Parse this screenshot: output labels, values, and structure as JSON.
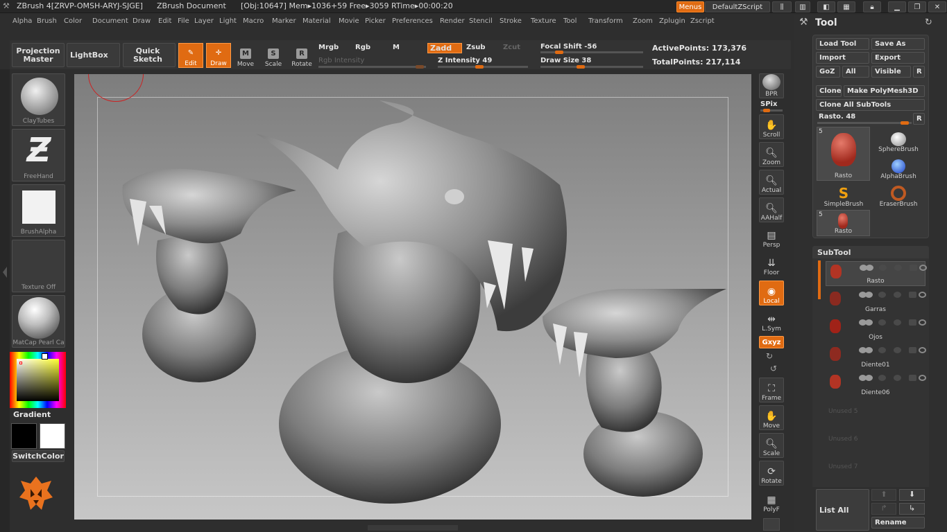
{
  "titlebar": {
    "app": "ZBrush 4[ZRVP-OMSH-ARYJ-SJGE]",
    "doc": "ZBrush Document",
    "stats": "[Obj:10647] Mem▸1036+59  Free▸3059  RTime▸00:00:20",
    "menus_btn": "Menus",
    "script_btn": "DefaultZScript"
  },
  "menu": [
    "Alpha",
    "Brush",
    "Color",
    "Document",
    "Draw",
    "Edit",
    "File",
    "Layer",
    "Light",
    "Macro",
    "Marker",
    "Material",
    "Movie",
    "Picker",
    "Preferences",
    "Render",
    "Stencil",
    "Stroke",
    "Texture",
    "Tool",
    "Transform",
    "Zoom",
    "Zplugin",
    "Zscript"
  ],
  "shelf": {
    "projection_master": "Projection Master",
    "lightbox": "LightBox",
    "quick_sketch": "Quick Sketch",
    "edit": "Edit",
    "draw": "Draw",
    "move": "Move",
    "scale": "Scale",
    "rotate": "Rotate",
    "mrgb": "Mrgb",
    "rgb": "Rgb",
    "m": "M",
    "zadd": "Zadd",
    "zsub": "Zsub",
    "zcut": "Zcut",
    "rgb_intensity": "Rgb Intensity",
    "z_intensity": "Z Intensity 49",
    "focal_shift": "Focal Shift -56",
    "draw_size": "Draw Size 38",
    "active_points": "ActivePoints: 173,376",
    "total_points": "TotalPoints: 217,114",
    "z_intensity_value": 49,
    "focal_shift_value": -56,
    "draw_size_value": 38
  },
  "left": {
    "brush": "ClayTubes",
    "stroke": "FreeHand",
    "alpha": "BrushAlpha",
    "texture": "Texture Off",
    "material": "MatCap Pearl Ca",
    "gradient": "Gradient",
    "switch_color": "SwitchColor"
  },
  "right_tools": {
    "bpr": "BPR",
    "spix": "SPix",
    "scroll": "Scroll",
    "zoom": "Zoom",
    "actual": "Actual",
    "aahalf": "AAHalf",
    "persp": "Persp",
    "floor": "Floor",
    "local": "Local",
    "lsym": "L.Sym",
    "xyz": "Gxyz",
    "frame": "Frame",
    "move": "Move",
    "scale": "Scale",
    "rotate": "Rotate",
    "polyf": "PolyF"
  },
  "tool": {
    "title": "Tool",
    "load_tool": "Load Tool",
    "save_as": "Save As",
    "import": "Import",
    "export": "Export",
    "goz": "GoZ",
    "all": "All",
    "visible": "Visible",
    "r": "R",
    "clone": "Clone",
    "make_polymesh": "Make PolyMesh3D",
    "clone_all": "Clone All SubTools",
    "rasto": "Rasto. 48",
    "brushes": [
      {
        "name": "Rasto",
        "badge": "5"
      },
      {
        "name": "SphereBrush"
      },
      {
        "name": "AlphaBrush"
      },
      {
        "name": "SimpleBrush"
      },
      {
        "name": "EraserBrush"
      },
      {
        "name": "Rasto",
        "badge": "5"
      }
    ],
    "subtool_title": "SubTool",
    "subtools": [
      "Rasto",
      "Garras",
      "Ojos",
      "Diente01",
      "Diente06"
    ],
    "unused": [
      "Unused 5",
      "Unused 6",
      "Unused 7"
    ],
    "list_all": "List All",
    "rename": "Rename"
  }
}
